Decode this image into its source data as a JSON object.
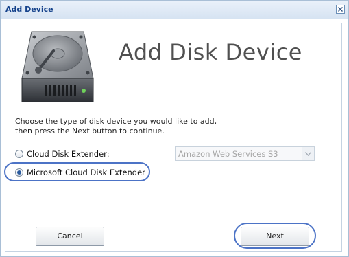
{
  "window": {
    "title": "Add Device",
    "close_icon": "close-icon"
  },
  "header": {
    "icon": "hard-disk-icon",
    "heading": "Add Disk Device"
  },
  "instructions": {
    "line1": "Choose the type of disk device you would like to add,",
    "line2": "then press the Next button to continue."
  },
  "options": [
    {
      "label": "Cloud Disk Extender:",
      "checked": false
    },
    {
      "label": "Microsoft Cloud Disk Extender",
      "checked": true
    }
  ],
  "provider_select": {
    "value": "Amazon Web Services S3",
    "enabled": false
  },
  "buttons": {
    "cancel": "Cancel",
    "next": "Next"
  },
  "colors": {
    "title_text": "#15428b",
    "highlight": "#4c73c6"
  }
}
